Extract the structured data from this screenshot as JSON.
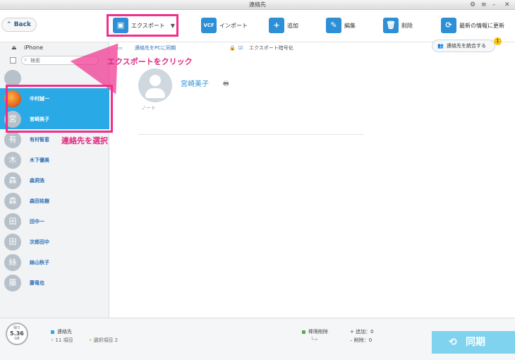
{
  "window": {
    "title": "連絡先"
  },
  "toolbar": {
    "back_label": "Back",
    "export_label": "エクスポート",
    "import_label": "インポート",
    "add_label": "追加",
    "edit_label": "編集",
    "delete_label": "削除",
    "refresh_label": "最新の情報に更新"
  },
  "subbar": {
    "sync_pc_label": "連絡先をPCに同期",
    "encrypt_label": "エクスポート暗号化",
    "merge_label": "連絡先を統合する",
    "merge_badge": "1"
  },
  "sidebar": {
    "device_label": "iPhone",
    "search_placeholder": "検索",
    "contacts": [
      {
        "initial": "",
        "name": ""
      },
      {
        "initial": "",
        "name": "中村誠一"
      },
      {
        "initial": "宮",
        "name": "宮崎美子"
      },
      {
        "initial": "有",
        "name": "有村智恵"
      },
      {
        "initial": "木",
        "name": "木下優美"
      },
      {
        "initial": "森",
        "name": "森洞浩"
      },
      {
        "initial": "森",
        "name": "森田祐樹"
      },
      {
        "initial": "田",
        "name": "田中一"
      },
      {
        "initial": "田",
        "name": "次郎田中"
      },
      {
        "initial": "絲",
        "name": "絲山秋子"
      },
      {
        "initial": "藤",
        "name": "藤竜也"
      }
    ]
  },
  "detail": {
    "name": "宮崎美子",
    "note_label": "ノート"
  },
  "footer": {
    "storage_label": "残り",
    "storage_value": "5.36",
    "storage_unit": "GB",
    "contacts_label": "連絡先",
    "items_count": "11 項目",
    "selected_count": "選択項目 2",
    "perm_delete_label": "棒限削除",
    "added_label": "+ 追加：0",
    "deleted_label": "– 削除：0",
    "sync_label": "同期"
  },
  "annotations": {
    "export_hint": "エクスポートをクリック",
    "select_hint": "連絡先を選択"
  }
}
